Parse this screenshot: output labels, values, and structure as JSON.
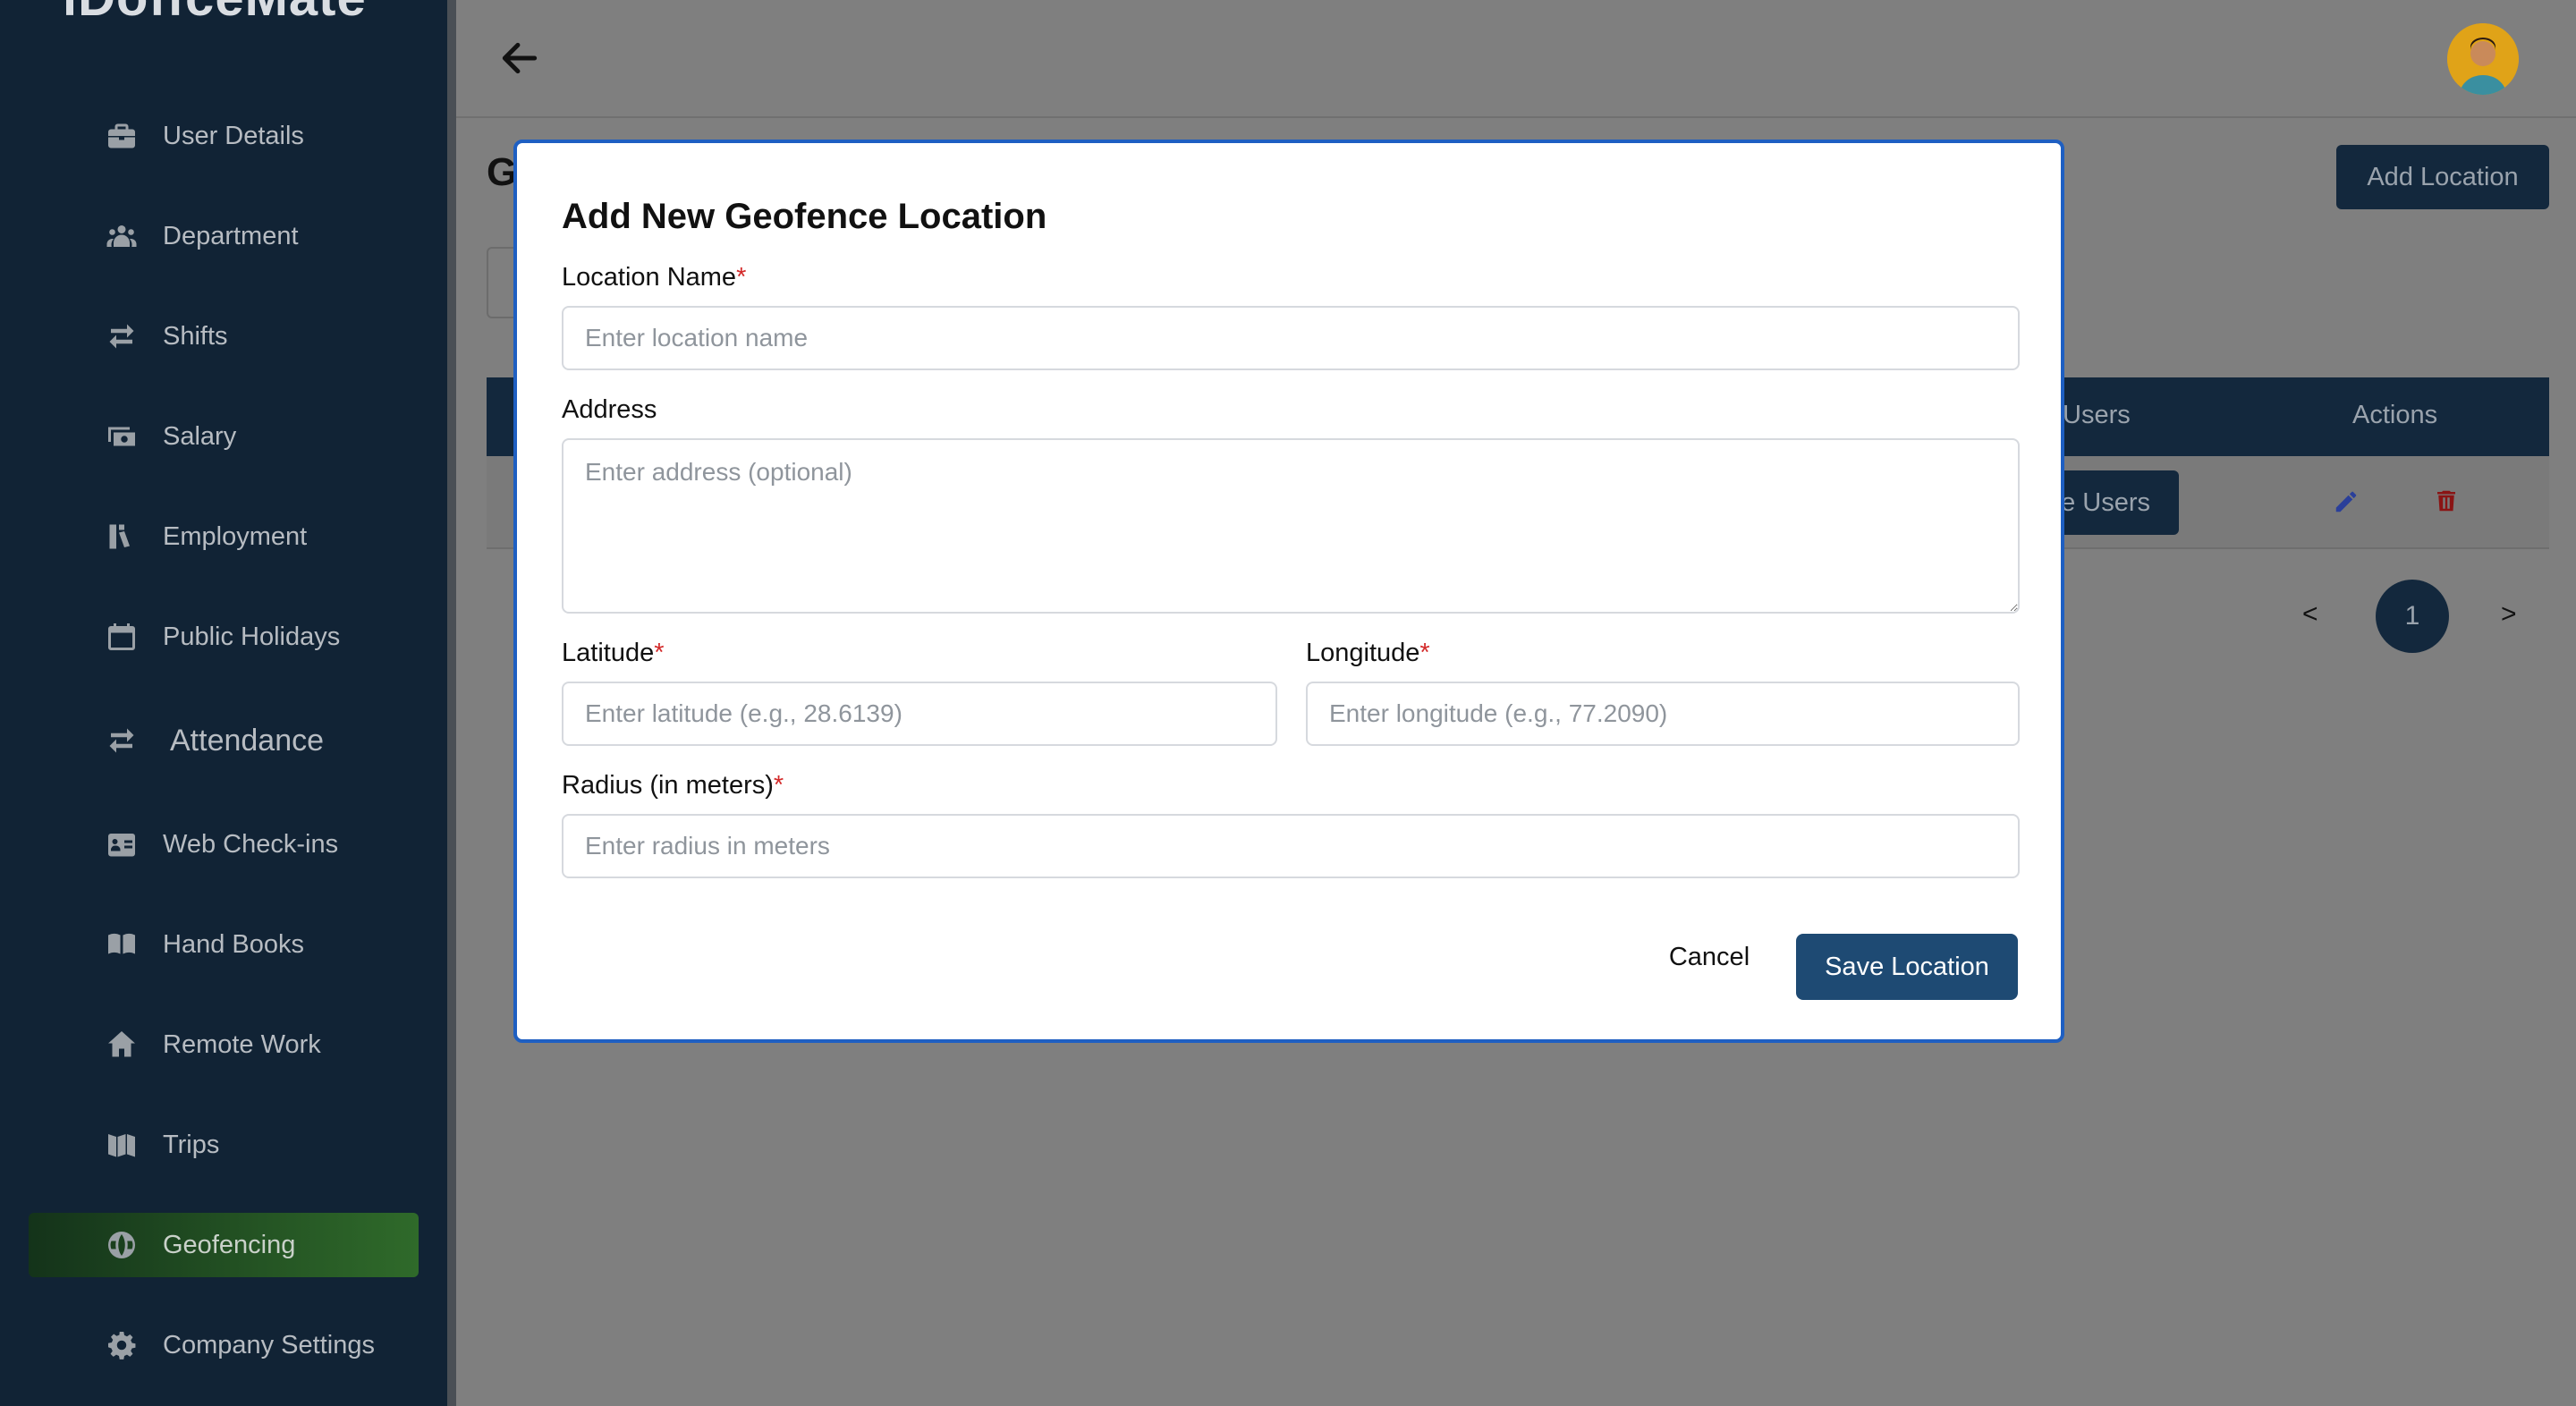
{
  "sidebar": {
    "logo": "iDoffceMate",
    "items": [
      {
        "label": "User Details",
        "icon": "briefcase-icon"
      },
      {
        "label": "Department",
        "icon": "users-icon"
      },
      {
        "label": "Shifts",
        "icon": "swap-arrows-icon"
      },
      {
        "label": "Salary",
        "icon": "money-icon"
      },
      {
        "label": "Employment",
        "icon": "employment-icon"
      },
      {
        "label": "Public Holidays",
        "icon": "calendar-icon"
      },
      {
        "label": "Attendance",
        "icon": "swap-arrows-icon"
      },
      {
        "label": "Web Check-ins",
        "icon": "id-card-icon"
      },
      {
        "label": "Hand Books",
        "icon": "book-icon"
      },
      {
        "label": "Remote Work",
        "icon": "home-icon"
      },
      {
        "label": "Trips",
        "icon": "map-icon"
      },
      {
        "label": "Geofencing",
        "icon": "globe-icon"
      },
      {
        "label": "Company Settings",
        "icon": "gear-icon"
      }
    ],
    "active": "Geofencing"
  },
  "page": {
    "title_partial": "G",
    "add_location_label": "Add Location",
    "table": {
      "headers": {
        "users": "Users",
        "actions": "Actions"
      },
      "row_button_partial": "e Users"
    },
    "pagination": {
      "prev": "<",
      "current": "1",
      "next": ">"
    }
  },
  "modal": {
    "title": "Add New Geofence Location",
    "location_name": {
      "label": "Location Name",
      "required": "*",
      "placeholder": "Enter location name"
    },
    "address": {
      "label": "Address",
      "placeholder": "Enter address (optional)"
    },
    "latitude": {
      "label": "Latitude",
      "required": "*",
      "placeholder": "Enter latitude (e.g., 28.6139)"
    },
    "longitude": {
      "label": "Longitude",
      "required": "*",
      "placeholder": "Enter longitude (e.g., 77.2090)"
    },
    "radius": {
      "label": "Radius (in meters)",
      "required": "*",
      "placeholder": "Enter radius in meters"
    },
    "cancel_label": "Cancel",
    "save_label": "Save Location"
  },
  "colors": {
    "sidebar_bg": "#112335",
    "overlay_bg": "#7f7f7f",
    "primary": "#1e4a73",
    "modal_border": "#1e5fc2",
    "required": "#d32a2a",
    "active_gradient_start": "#14331a",
    "active_gradient_end": "#2f6a2a"
  }
}
